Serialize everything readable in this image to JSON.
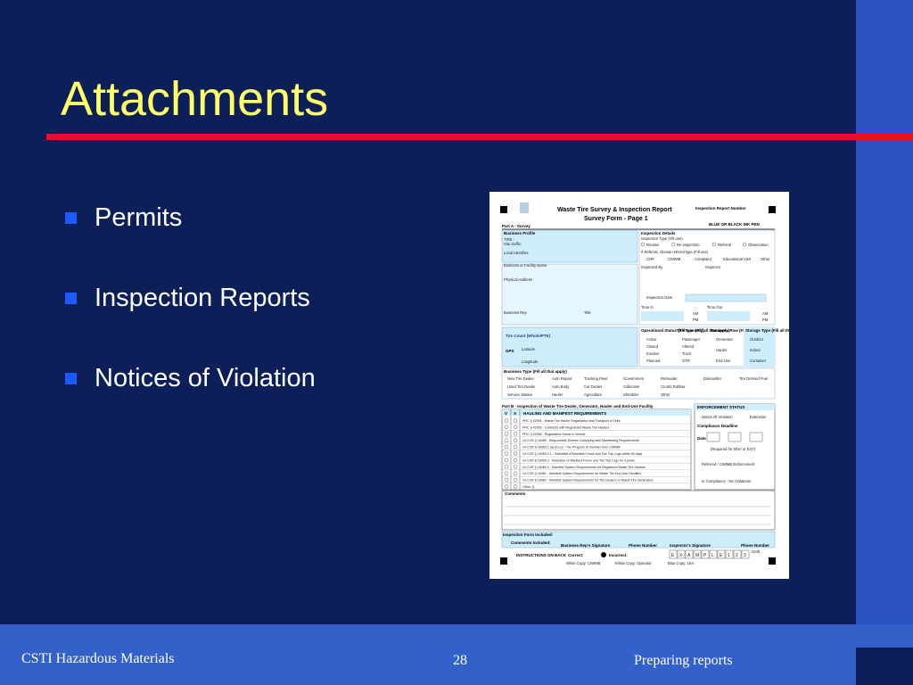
{
  "slide": {
    "title": "Attachments",
    "bullets": [
      {
        "label": "Permits"
      },
      {
        "label": "Inspection Reports"
      },
      {
        "label": "Notices of Violation"
      }
    ]
  },
  "footer": {
    "left": "CSTI Hazardous Materials",
    "page": "28",
    "right": "Preparing reports"
  },
  "form": {
    "title_line1": "Waste Tire Survey & Inspection Report",
    "title_line2": "Survey Form - Page 1",
    "report_number_label": "Inspection Report Number",
    "ink_note": "BLUE OR BLACK INK PEN",
    "part_a": "Part A - Survey",
    "business_profile": "Business Profile",
    "inspection_details": "Inspection Details",
    "inspection_type": "Inspection Type (Fill one)",
    "type_options": [
      "Routine",
      "Re-inspection",
      "Referral",
      "Observation"
    ],
    "referral_label": "If Referral, choose referral type (Fill one)",
    "referral_options": [
      "CHP",
      "CIWMB",
      "Complaint",
      "Educational Visit",
      "Other"
    ],
    "tire_id": "TIRE -",
    "site_suffix": "Site Suffix:",
    "local_identifier": "Local Identifier:",
    "business_name": "Business or Facility Name",
    "inspected_by": "Inspected By",
    "inspector": "Inspector",
    "physical_address": "Physical Address",
    "inspection_date": "Inspection Date",
    "business_rep": "Business Rep",
    "title_field": "Title",
    "time_in": "Time In",
    "time_out": "Time Out",
    "am": "AM",
    "pm": "PM",
    "tire_count": "Tire Count (Whole/PTE)",
    "gps": "GPS",
    "latitude": "Latitude",
    "longitude": "Longitude",
    "operational_status": "Operational Status (Fill one only)",
    "status_options": [
      "Active",
      "Closed",
      "Inactive",
      "Planned"
    ],
    "tire_type": "Tire Type (Fill all that apply)",
    "tire_type_options": [
      "Passenger",
      "Altered",
      "Truck",
      "OTR"
    ],
    "business_row": "Business Row (Fill all that apply)",
    "business_row_options": [
      "Generator",
      "Hauler",
      "End-Use"
    ],
    "storage_type": "Storage Type (Fill all that apply)",
    "storage_options": [
      "Outdoor",
      "Indoor",
      "Container"
    ],
    "business_type": "Business Type (Fill all that apply)",
    "business_types_row1": [
      "New Tire Dealer",
      "Auto Repair",
      "Trucking Fleet",
      "Government",
      "Retreader",
      "Dismantler",
      "Tire Derived Fuel"
    ],
    "business_types_row2": [
      "Used Tire Dealer",
      "Auto Body",
      "Car Dealer",
      "Collection",
      "Crumb Rubber"
    ],
    "business_types_row3": [
      "Service Station",
      "Hauler",
      "Agriculture",
      "Shredder",
      "Other"
    ],
    "part_b": "Part B - Inspection of Waste Tire Dealer, Generator, Hauler and End-Use Facility",
    "enforcement_status": "ENFORCEMENT STATUS",
    "va_header": [
      "V",
      "A"
    ],
    "requirements_header": "HAULING AND MANIFEST REQUIREMENTS",
    "requirements": [
      "PRC § 42951 - Waste Tire Hauler Registration and Transport of Tires",
      "PRC § 42953 - Contracts with Registered Waste Tire Haulers",
      "PRC § 42956 - Registration Decal in Vehicle",
      "14 CCR § 18459 - Responsible Entities Complying with Manifesting Requirements",
      "14 CCR § 18459.1 (a) (b) (c) - Tire Program ID Number from CIWMB",
      "14 CCR § 18459.2.1 - Submittal of Manifest Forms and Tire Trip Logs within 90 days",
      "14 CCR § 18459.3 - Retention of Manifest Forms and Tire Trip Logs for 3 years",
      "14 CCR § 18460.2 - Manifest System Requirements for Registered Waste Tire Haulers",
      "14 CCR § 18461 - Manifest System Requirements for Waste Tire End-Use Facilities",
      "14 CCR § 18462 - Manifest System Requirements for Tire Dealers or Waste Tire Generators",
      "Other: §"
    ],
    "notice_of_violation": "Notice Of Violation",
    "extension": "Extension",
    "compliance_deadline": "Compliance Deadline",
    "date_label": "Date",
    "required_note": "(Required for NOV or EXT)",
    "referred": "Referred / CIWMB Enforcement",
    "in_compliance": "In Compliance - No Violations",
    "comments": "Comments",
    "inspection_form_included": "Inspection Form Included:",
    "comments_included": "Comments Included:",
    "signature_label": "Business Rep's Signature",
    "phone_label": "Phone Number",
    "inspector_signature": "Inspector's Signature",
    "phone_label2": "Phone Number",
    "draft": "Draft",
    "instructions": "INSTRUCTIONS ON BACK",
    "correct": "Correct:",
    "incorrect": "Incorrect:",
    "example": [
      "E",
      "X",
      "A",
      "M",
      "P",
      "L",
      "E",
      "1",
      "2",
      "3"
    ],
    "copies": [
      "White Copy: CIWMB",
      "Yellow Copy: Operator",
      "Blue Copy: LEA"
    ]
  },
  "colors": {
    "background": "#0c1f58",
    "title": "#ffff66",
    "rule": "#e3112a",
    "bullet": "#1e5bff",
    "footer_band": "#3361c9",
    "form_shade": "#cfeefd"
  }
}
